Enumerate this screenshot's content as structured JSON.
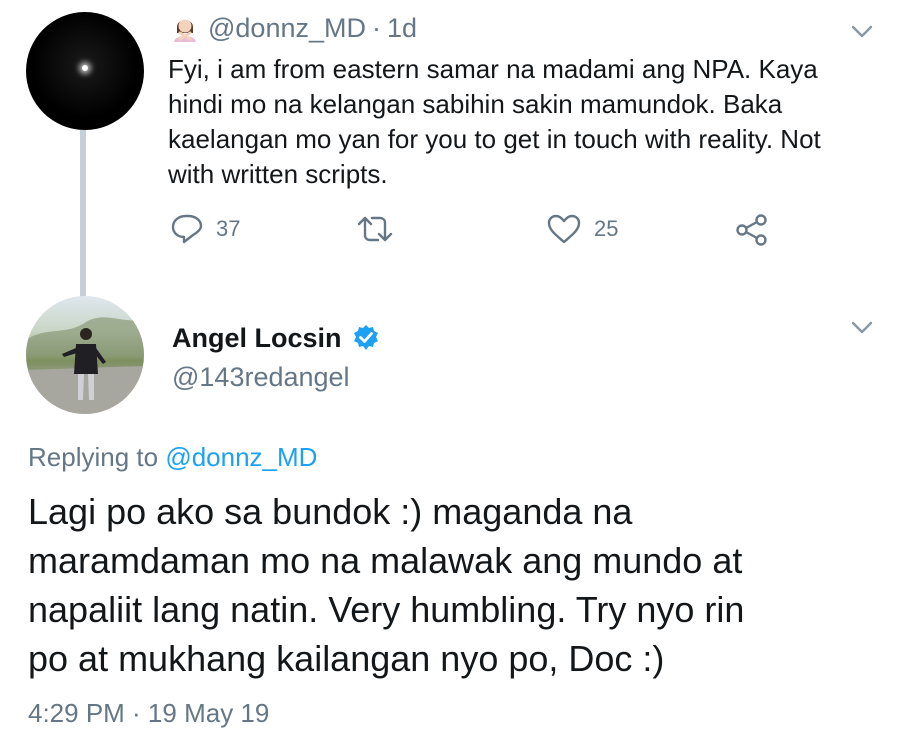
{
  "tweet1": {
    "handle": "@donnz_MD",
    "separator": "·",
    "time": "1d",
    "emoji_icon": "person-gesturing-no-emoji",
    "text": "Fyi, i am from eastern samar na madami ang NPA. Kaya\nhindi mo na kelangan sabihin sakin mamundok. Baka\nkaelangan mo yan for you to get in touch with reality. Not\nwith written scripts.",
    "actions": {
      "reply_count": "37",
      "retweet_count": "",
      "like_count": "25"
    }
  },
  "tweet2": {
    "name": "Angel Locsin",
    "handle": "@143redangel",
    "reply_prefix": "Replying to ",
    "reply_to": "@donnz_MD",
    "text": "Lagi po ako sa bundok :) maganda na\nmaramdaman mo na malawak ang mundo at\nnapaliit lang natin. Very humbling. Try nyo rin\npo at mukhang kailangan nyo po, Doc :)",
    "timestamp": "4:29 PM · 19 May 19"
  },
  "colors": {
    "text_primary": "#14171a",
    "text_secondary": "#657786",
    "link": "#1da1f2",
    "thread_line": "#c4cfd6"
  }
}
